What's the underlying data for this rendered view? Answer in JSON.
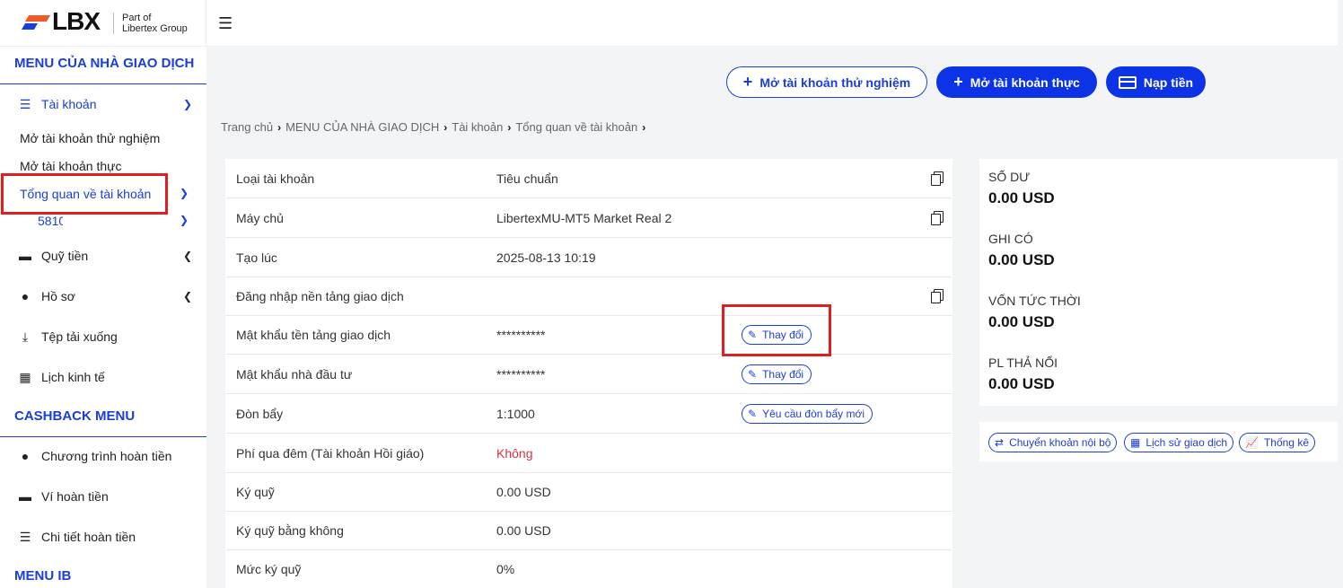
{
  "brand": {
    "logo_text": "LBX",
    "sub_line1": "Part of",
    "sub_line2": "Libertex Group"
  },
  "sidebar": {
    "trader_menu_title": "MENU CỦA NHÀ GIAO DỊCH",
    "accounts_label": "Tài khoản",
    "open_demo": "Mở tài khoản thử nghiệm",
    "open_real": "Mở tài khoản thực",
    "overview": "Tổng quan về tài khoản",
    "account_number": "5810",
    "funds": "Quỹ tiền",
    "profile": "Hồ sơ",
    "downloads": "Tệp tải xuống",
    "calendar": "Lịch kinh tế",
    "cashback_title": "CASHBACK MENU",
    "cashback_program": "Chương trình hoàn tiền",
    "cashback_wallet": "Ví hoàn tiền",
    "cashback_details": "Chi tiết hoàn tiền",
    "ib_title": "MENU IB"
  },
  "header": {
    "btn_demo": "Mở tài khoản thử nghiệm",
    "btn_real": "Mở tài khoản thực",
    "btn_deposit": "Nạp tiền"
  },
  "breadcrumb": [
    "Trang chủ",
    "MENU CỦA NHÀ GIAO DỊCH",
    "Tài khoản",
    "Tổng quan về tài khoản"
  ],
  "details": {
    "rows": [
      {
        "label": "Loại tài khoản",
        "value": "Tiêu chuẩn"
      },
      {
        "label": "Máy chủ",
        "value": "LibertexMU-MT5 Market Real 2"
      },
      {
        "label": "Tạo lúc",
        "value": "2025-08-13 10:19"
      },
      {
        "label": "Đăng nhập nền tảng giao dịch",
        "value": ""
      },
      {
        "label": "Mật khẩu tền tảng giao dịch",
        "value": "**********",
        "action": "Thay đổi"
      },
      {
        "label": "Mật khẩu nhà đầu tư",
        "value": "**********",
        "action": "Thay đổi"
      },
      {
        "label": "Đòn bẩy",
        "value": "1:1000",
        "action": "Yêu cầu đòn bẩy mới"
      },
      {
        "label": "Phí qua đêm (Tài khoản Hồi giáo)",
        "value": "Không"
      },
      {
        "label": "Ký quỹ",
        "value": "0.00 USD"
      },
      {
        "label": "Ký quỹ bằng không",
        "value": "0.00 USD"
      },
      {
        "label": "Mức ký quỹ",
        "value": "0%"
      }
    ],
    "swap_color": "#d8323d"
  },
  "balances": [
    {
      "label": "SỐ DƯ",
      "value": "0.00 USD"
    },
    {
      "label": "GHI CÓ",
      "value": "0.00 USD"
    },
    {
      "label": "VỐN TỨC THỜI",
      "value": "0.00 USD"
    },
    {
      "label": "PL THẢ NỔI",
      "value": "0.00 USD"
    }
  ],
  "actions": {
    "transfer": "Chuyển khoản nội bộ",
    "history": "Lịch sử giao dịch",
    "stats": "Thống kê"
  },
  "colors": {
    "accent": "#1a3ed8",
    "primary_button": "#0d33e6",
    "highlight_box": "#e11d1d",
    "logo_orange": "#f05a28"
  }
}
